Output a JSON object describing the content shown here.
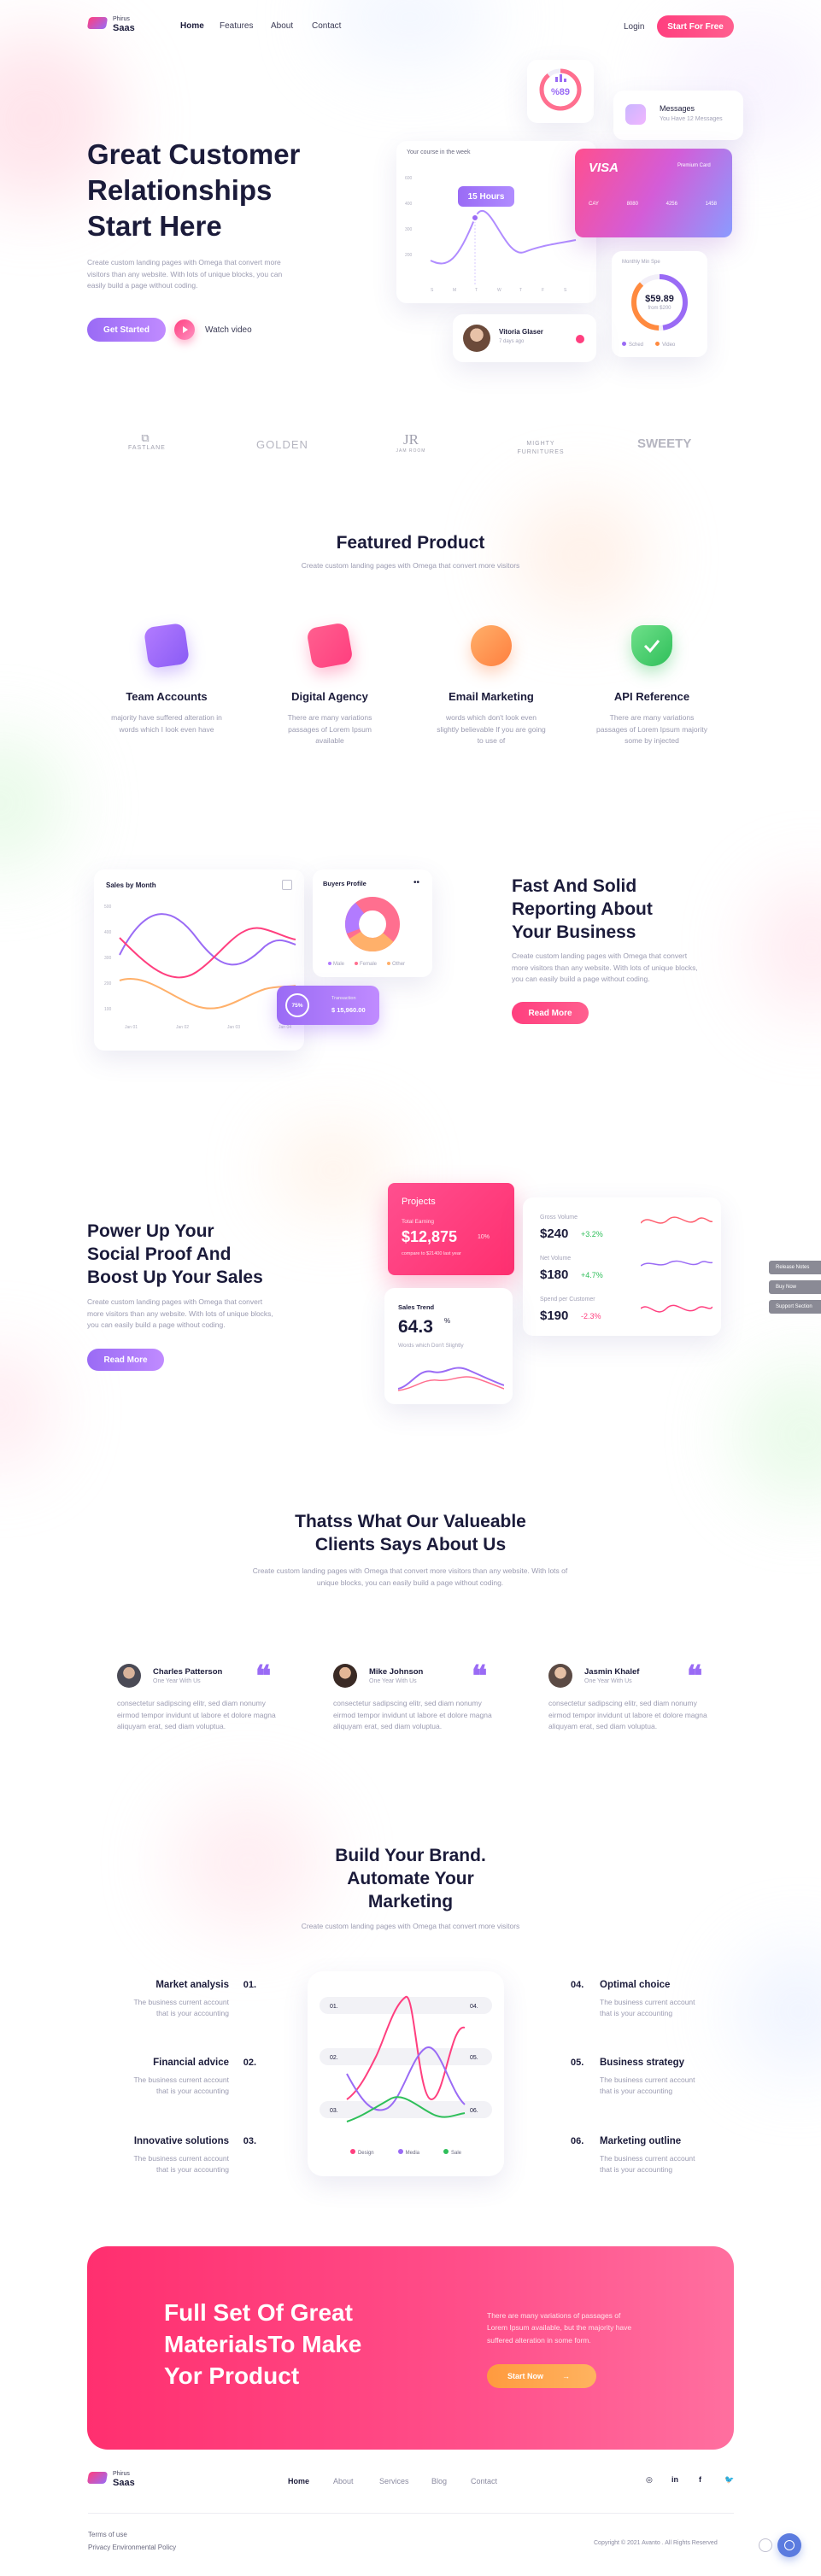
{
  "brand": {
    "top": "Phirus",
    "bottom": "Saas"
  },
  "nav": {
    "home": "Home",
    "features": "Features",
    "about": "About",
    "contact": "Contact",
    "login": "Login",
    "cta": "Start For Free"
  },
  "hero": {
    "title_1": "Great Customer",
    "title_2": "Relationships",
    "title_3": "Start Here",
    "desc": "Create custom landing pages with Omega that convert more visitors than any website. With lots of unique blocks, you can easily build a page without coding.",
    "primary": "Get Started",
    "secondary": "Watch video"
  },
  "hero_cards": {
    "percent": "%89",
    "messages_title": "Messages",
    "messages_sub": "You Have 12 Messages",
    "chart_title": "Your course in the week",
    "hours": "15 Hours",
    "chart_y": [
      "600",
      "400",
      "300",
      "200"
    ],
    "chart_x": [
      "S",
      "M",
      "T",
      "W",
      "T",
      "F",
      "S"
    ],
    "visa": "VISA",
    "visa_sub": "Premium Card",
    "visa_numbers": [
      "CAY",
      "8080",
      "4256",
      "1458"
    ],
    "monthly_title": "Monthly Min Spe",
    "monthly_value": "$59.89",
    "monthly_sub": "from $200",
    "monthly_legend": [
      "Sched",
      "Video"
    ],
    "user_name": "Vitoria Glaser",
    "user_sub": "7 days ago"
  },
  "logos": [
    "FASTLANE",
    "GOLDEN",
    "JR",
    "MIGHTY FURNITURES",
    "SWEETY"
  ],
  "logo_subs": [
    "",
    "",
    "JAM ROOM",
    "",
    ""
  ],
  "featured": {
    "title": "Featured Product",
    "sub": "Create custom landing pages with Omega that convert more visitors",
    "items": [
      {
        "title": "Team Accounts",
        "desc": "majority have suffered alteration in words which I look even have"
      },
      {
        "title": "Digital Agency",
        "desc": "There are many variations passages of Lorem Ipsum available"
      },
      {
        "title": "Email Marketing",
        "desc": "words which don't look even slightly believable If you are going to use of"
      },
      {
        "title": "API Reference",
        "desc": "There are many variations passages of Lorem Ipsum majority some by injected"
      }
    ]
  },
  "reporting": {
    "title_1": "Fast And Solid",
    "title_2": "Reporting About",
    "title_3": "Your Business",
    "desc": "Create custom landing pages with Omega that convert more visitors than any website. With lots of unique blocks, you can easily build a page without coding.",
    "cta": "Read More",
    "sales_title": "Sales by Month",
    "sales_y": [
      "500",
      "400",
      "300",
      "200",
      "100"
    ],
    "sales_x": [
      "Jan 01",
      "Jan 02",
      "Jan 03",
      "Jan 04"
    ],
    "buyers_title": "Buyers Profile",
    "buyers_legend": [
      "Male",
      "Female",
      "Other"
    ],
    "progress_pct": "75%",
    "progress_label": "Transaction",
    "progress_value": "$ 15,960.00"
  },
  "social": {
    "title_1": "Power Up Your",
    "title_2": "Social Proof And",
    "title_3": "Boost Up Your Sales",
    "desc": "Create custom landing pages with Omega that convert more visitors than any website. With lots of unique blocks, you can easily build a page without coding.",
    "cta": "Read More",
    "projects_title": "Projects",
    "projects_label": "Total Earning",
    "projects_value": "$12,875",
    "projects_change": "10%",
    "projects_sub": "compare to $21400 last year",
    "trend_title": "Sales Trend",
    "trend_value": "64.3",
    "trend_unit": "%",
    "trend_sub": "Words which Don't Slightly",
    "stats": [
      {
        "label": "Gross Volume",
        "value": "$240",
        "change": "+3.2%"
      },
      {
        "label": "Net Volume",
        "value": "$180",
        "change": "+4.7%"
      },
      {
        "label": "Spend per Customer",
        "value": "$190",
        "change": "-2.3%"
      }
    ]
  },
  "side_buttons": [
    "Release Notes",
    "Buy Now",
    "Support Section"
  ],
  "testimonials": {
    "title_1": "Thatss What Our Valueable",
    "title_2": "Clients Says About Us",
    "sub": "Create custom landing pages with Omega that convert more visitors than any website. With lots of unique blocks, you can easily build a page without coding.",
    "items": [
      {
        "name": "Charles Patterson",
        "role": "One Year With Us",
        "text": "consectetur sadipscing elitr, sed diam nonumy eirmod tempor invidunt ut labore et dolore magna aliquyam erat, sed diam voluptua."
      },
      {
        "name": "Mike Johnson",
        "role": "One Year With Us",
        "text": "consectetur sadipscing elitr, sed diam nonumy eirmod tempor invidunt ut labore et dolore magna aliquyam erat, sed diam voluptua."
      },
      {
        "name": "Jasmin Khalef",
        "role": "One Year With Us",
        "text": "consectetur sadipscing elitr, sed diam nonumy eirmod tempor invidunt ut labore et dolore magna aliquyam erat, sed diam voluptua."
      }
    ]
  },
  "brand_section": {
    "title_1": "Build Your Brand.",
    "title_2": "Automate Your",
    "title_3": "Marketing",
    "sub": "Create custom landing pages with Omega that convert more visitors",
    "left": [
      {
        "num": "01.",
        "title": "Market analysis",
        "desc": "The business current account that is your accounting"
      },
      {
        "num": "02.",
        "title": "Financial advice",
        "desc": "The business current account that is your accounting"
      },
      {
        "num": "03.",
        "title": "Innovative solutions",
        "desc": "The business current account that is your accounting"
      }
    ],
    "right": [
      {
        "num": "04.",
        "title": "Optimal choice",
        "desc": "The business current account that is your accounting"
      },
      {
        "num": "05.",
        "title": "Business strategy",
        "desc": "The business current account that is your accounting"
      },
      {
        "num": "06.",
        "title": "Marketing outline",
        "desc": "The business current account that is your accounting"
      }
    ],
    "chart_tags": [
      "01.",
      "04.",
      "02.",
      "05.",
      "03.",
      "06."
    ],
    "legend": [
      "Design",
      "Media",
      "Sale"
    ]
  },
  "cta_banner": {
    "title_1": "Full Set Of Great",
    "title_2": "MaterialsTo Make",
    "title_3": "Yor Product",
    "desc": "There are many variations of passages of Lorem Ipsum available, but the majority have suffered alteration in some form.",
    "button": "Start Now"
  },
  "footer": {
    "nav": [
      "Home",
      "About",
      "Services",
      "Blog",
      "Contact"
    ],
    "terms": "Terms of use",
    "privacy": "Privacy Environmental Policy",
    "copyright": "Copyright © 2021 Avanto . All Rights Reserved"
  },
  "colors": {
    "pink": "#ff3f7f",
    "purple": "#9a6bf5",
    "dark": "#1b1b3a"
  }
}
